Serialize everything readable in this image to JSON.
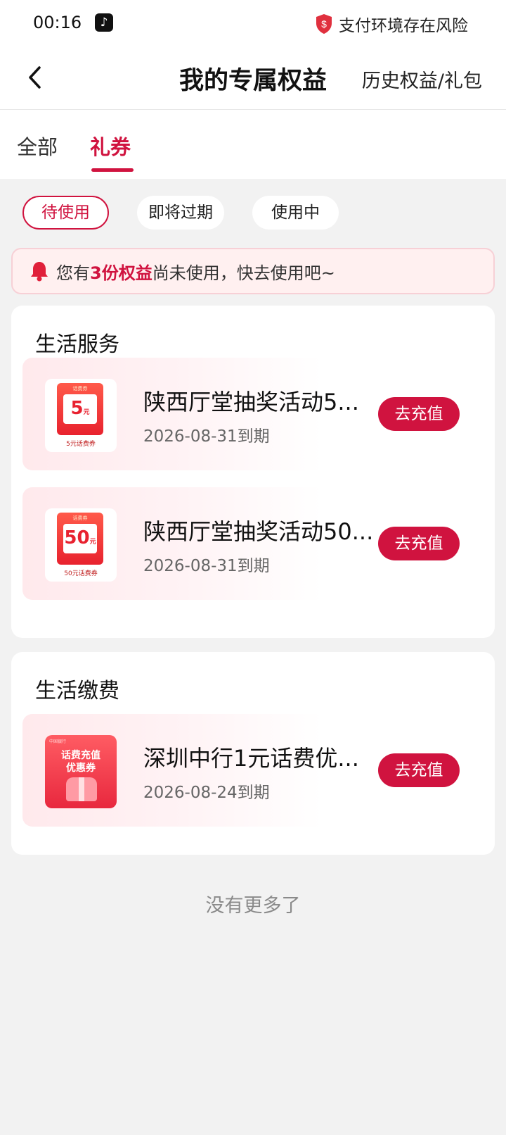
{
  "status_bar": {
    "time": "00:16",
    "app_icon": "♪",
    "risk_text": "支付环境存在风险"
  },
  "nav": {
    "title": "我的专属权益",
    "history": "历史权益/礼包"
  },
  "tabs": [
    {
      "label": "全部"
    },
    {
      "label": "礼券"
    }
  ],
  "filters": [
    {
      "label": "待使用"
    },
    {
      "label": "即将过期"
    },
    {
      "label": "使用中"
    }
  ],
  "notice": {
    "prefix": "您有",
    "highlight": "3份权益",
    "suffix": "尚未使用，快去使用吧~"
  },
  "sections": [
    {
      "title": "生活服务",
      "items": [
        {
          "name": "陕西厅堂抽奖活动5...",
          "date": "2026-08-31到期",
          "button": "去充值",
          "thumb": {
            "tag": "话费券",
            "amount": "5",
            "unit": "元",
            "caption": "5元话费券"
          }
        },
        {
          "name": "陕西厅堂抽奖活动50...",
          "date": "2026-08-31到期",
          "button": "去充值",
          "thumb": {
            "tag": "话费券",
            "amount": "50",
            "unit": "元",
            "caption": "50元话费券"
          }
        }
      ]
    },
    {
      "title": "生活缴费",
      "items": [
        {
          "name": "深圳中行1元话费优...",
          "date": "2026-08-24到期",
          "button": "去充值",
          "thumb": {
            "bank": "中国银行",
            "line1": "话费充值",
            "line2": "优惠券"
          }
        }
      ]
    }
  ],
  "footer": "没有更多了",
  "colors": {
    "accent": "#d0133f",
    "background": "#f2f2f2"
  }
}
